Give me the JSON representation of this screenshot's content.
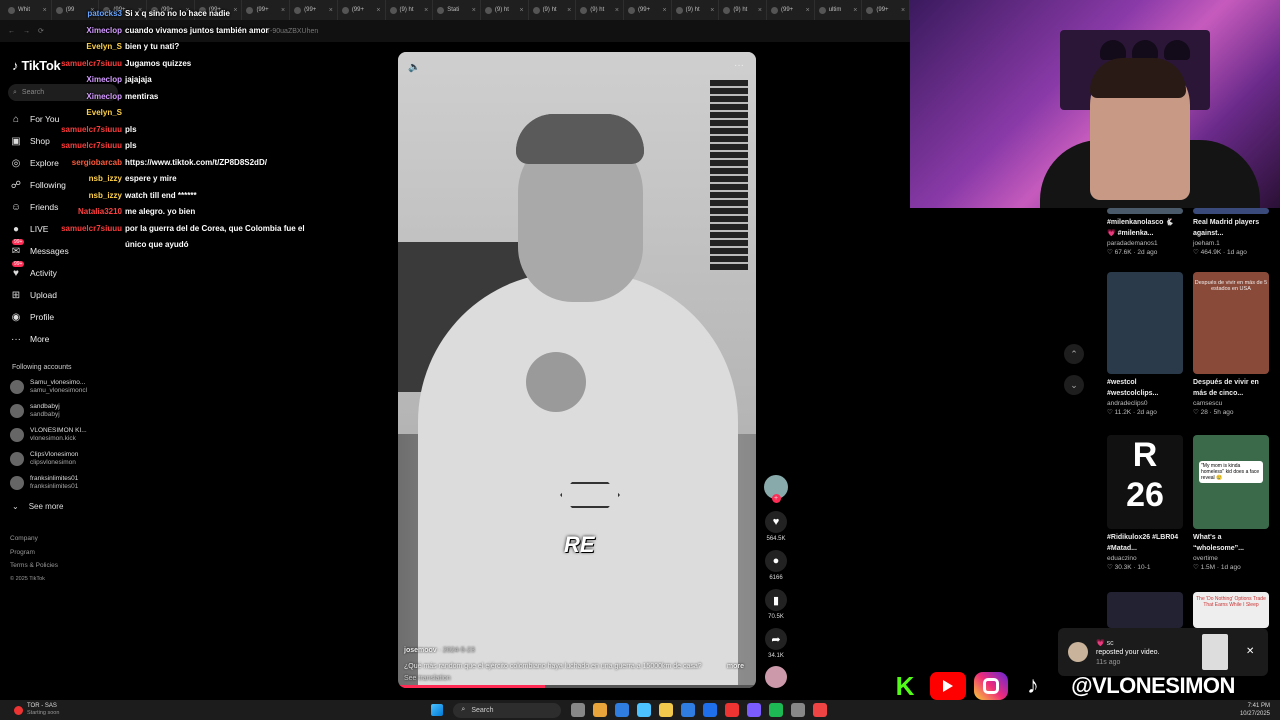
{
  "browser": {
    "tabs": [
      {
        "label": "Whit"
      },
      {
        "label": "(99"
      },
      {
        "label": "(99+"
      },
      {
        "label": "(99+"
      },
      {
        "label": "(99+"
      },
      {
        "label": "(99+"
      },
      {
        "label": "(99+"
      },
      {
        "label": "(99+"
      },
      {
        "label": "(9) ht"
      },
      {
        "label": "Stati"
      },
      {
        "label": "(9) ht"
      },
      {
        "label": "(9) ht"
      },
      {
        "label": "(9) ht"
      },
      {
        "label": "(99+"
      },
      {
        "label": "(9) ht"
      },
      {
        "label": "(9) ht"
      },
      {
        "label": "(99+"
      },
      {
        "label": "ultim"
      },
      {
        "label": "(99+"
      }
    ],
    "url": "ZT-90uaZBXUhen"
  },
  "sidebar": {
    "logo": "TikTok",
    "search_placeholder": "Search",
    "nav": [
      {
        "label": "For You",
        "icon": "home-icon"
      },
      {
        "label": "Shop",
        "icon": "bag-icon"
      },
      {
        "label": "Explore",
        "icon": "compass-icon"
      },
      {
        "label": "Following",
        "icon": "following-icon"
      },
      {
        "label": "Friends",
        "icon": "friends-icon"
      },
      {
        "label": "LIVE",
        "icon": "live-icon"
      },
      {
        "label": "Messages",
        "icon": "messages-icon",
        "badge": "99+"
      },
      {
        "label": "Activity",
        "icon": "activity-icon",
        "badge": "99+"
      },
      {
        "label": "Upload",
        "icon": "upload-icon"
      },
      {
        "label": "Profile",
        "icon": "profile-icon"
      },
      {
        "label": "More",
        "icon": "more-icon"
      }
    ],
    "following_title": "Following accounts",
    "accounts": [
      {
        "name": "Samu_vlonesimo...",
        "handle": "samu_vlonesimoncl"
      },
      {
        "name": "sandbabyj",
        "handle": "sandbabyj"
      },
      {
        "name": "VLONESIMON KI...",
        "handle": "vlonesimon.kick"
      },
      {
        "name": "ClipsVlonesimon",
        "handle": "clipsvlonesimon"
      },
      {
        "name": "franksinlimites01",
        "handle": "franksinlimites01"
      }
    ],
    "see_more": "See more",
    "footer": [
      "Company",
      "Program",
      "Terms & Policies",
      "© 2025 TikTok"
    ]
  },
  "chat": [
    {
      "user": "patocks3",
      "color": "#6aa6ff",
      "msg": "Si x q sino no lo hace nadie"
    },
    {
      "user": "Ximeclop",
      "color": "#d39bff",
      "msg": "cuando vivamos juntos también amor"
    },
    {
      "user": "Evelyn_S",
      "color": "#ffd24a",
      "msg": "bien y tu nati?"
    },
    {
      "user": "samuelcr7siuuu",
      "color": "#ff3b3b",
      "msg": "Jugamos quizzes"
    },
    {
      "user": "Ximeclop",
      "color": "#d39bff",
      "msg": "jajajaja"
    },
    {
      "user": "Ximeclop",
      "color": "#d39bff",
      "msg": "mentiras"
    },
    {
      "user": "Evelyn_S",
      "color": "#ffd24a",
      "msg": ""
    },
    {
      "user": "samuelcr7siuuu",
      "color": "#ff3b3b",
      "msg": "pls"
    },
    {
      "user": "samuelcr7siuuu",
      "color": "#ff3b3b",
      "msg": "pls"
    },
    {
      "user": "sergiobarcab",
      "color": "#ff5a3c",
      "msg": "https://www.tiktok.com/t/ZP8D8S2dD/"
    },
    {
      "user": "nsb_izzy",
      "color": "#ffd24a",
      "msg": "espere y mire"
    },
    {
      "user": "nsb_izzy",
      "color": "#ffd24a",
      "msg": "watch till end ******"
    },
    {
      "user": "Natalia3210",
      "color": "#ff4040",
      "msg": "me alegro. yo bien"
    },
    {
      "user": "samuelcr7siuuu",
      "color": "#ff3b3b",
      "msg": "por la guerra del de Corea, que Colombia fue el"
    },
    {
      "user": "",
      "color": "#ffffff",
      "msg": "único que ayudó"
    }
  ],
  "video": {
    "overlay_text": "RE",
    "author": "josemoov",
    "date": "2024-5-23",
    "caption": "¿Qué más random que el ejército colombiano haya luchado en una guerra a 15000km de casa?",
    "more": "more",
    "see_translation": "See translation",
    "progress": 0.41
  },
  "actions": [
    {
      "icon": "heart-icon",
      "count": "564.5K"
    },
    {
      "icon": "comment-icon",
      "count": "6166"
    },
    {
      "icon": "bookmark-icon",
      "count": "70.5K"
    },
    {
      "icon": "share-icon",
      "count": "34.1K"
    }
  ],
  "grid": [
    {
      "caption": "#milenkanolasco 🐇 💗 #milenka...",
      "author": "paradademanos1",
      "views": "67.6K",
      "age": "2d ago",
      "color": "#4a5a6a"
    },
    {
      "caption": "Real Madrid players against...",
      "author": "joeham.1",
      "views": "464.9K",
      "age": "1d ago",
      "color": "#3a4a7a"
    },
    {
      "caption": "#westcol #westcolclips...",
      "author": "andradeclips0",
      "views": "11.2K",
      "age": "2d ago",
      "color": "#2a3a4a"
    },
    {
      "caption": "Después de vivir en más de cinco...",
      "author": "camsescu",
      "views": "28",
      "age": "5h ago",
      "color": "#8a4a3a"
    },
    {
      "caption": "#Ridikulox26 #LBR04 #Matad...",
      "author": "eduaczino",
      "views": "30.3K",
      "age": "10-1",
      "color": "#111111"
    },
    {
      "caption": "What's a “wholesome”...",
      "author": "overtime",
      "views": "1.5M",
      "age": "1d ago",
      "color": "#3a6a4a"
    }
  ],
  "thumb_text": {
    "t4": "Después de vivir en más de 5 estados en USA",
    "t6": "\"My mom is kinda homeless\" kid does a face reveal 😢",
    "t8": "The 'Do Nothing' Options Trade That Earns While I Sleep"
  },
  "notification": {
    "name": "sc",
    "text": "reposted your video.",
    "time": "11s ago"
  },
  "brand": {
    "handle": "@VLONESIMON"
  },
  "taskbar": {
    "weather_title": "TOR - SAS",
    "weather_sub": "Starting soon",
    "search": "Search",
    "time": "7:41 PM",
    "date": "10/27/2025"
  },
  "colors": {
    "accent": "#fe2c55",
    "kick": "#53fc18",
    "youtube": "#ff0000"
  }
}
